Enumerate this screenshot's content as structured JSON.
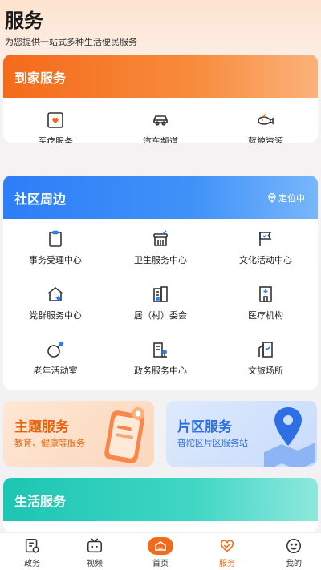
{
  "header": {
    "title": "服务",
    "subtitle": "为您提供一站式多种生活便民服务"
  },
  "home_service": {
    "title": "到家服务",
    "items": [
      {
        "label": "医疗服务",
        "icon": "medical-box-icon"
      },
      {
        "label": "汽车频道",
        "icon": "car-icon"
      },
      {
        "label": "蓝鲸资源",
        "icon": "whale-icon"
      }
    ]
  },
  "community": {
    "title": "社区周边",
    "location": "定位中",
    "items": [
      {
        "label": "事务受理中心",
        "icon": "clipboard-icon"
      },
      {
        "label": "卫生服务中心",
        "icon": "broom-icon"
      },
      {
        "label": "文化活动中心",
        "icon": "flag-icon"
      },
      {
        "label": "党群服务中心",
        "icon": "house-star-icon"
      },
      {
        "label": "居（村）委会",
        "icon": "building-icon"
      },
      {
        "label": "医疗机构",
        "icon": "hospital-icon"
      },
      {
        "label": "老年活动室",
        "icon": "ball-icon"
      },
      {
        "label": "政务服务中心",
        "icon": "government-building-icon"
      },
      {
        "label": "文旅场所",
        "icon": "venue-icon"
      }
    ]
  },
  "promos": [
    {
      "title": "主题服务",
      "subtitle": "教育、健康等服务"
    },
    {
      "title": "片区服务",
      "subtitle": "普陀区片区服务站"
    }
  ],
  "life_service": {
    "title": "生活服务"
  },
  "tabbar": {
    "items": [
      {
        "label": "政务",
        "icon": "government-affairs-icon"
      },
      {
        "label": "视频",
        "icon": "tv-icon"
      },
      {
        "label": "首页",
        "icon": "home-icon"
      },
      {
        "label": "服务",
        "icon": "heart-hands-icon"
      },
      {
        "label": "我的",
        "icon": "smiley-icon"
      }
    ],
    "active": "服务"
  },
  "colors": {
    "accent_orange": "#f46a1a",
    "accent_blue": "#2d7ef7",
    "accent_teal": "#1dc5b3"
  }
}
